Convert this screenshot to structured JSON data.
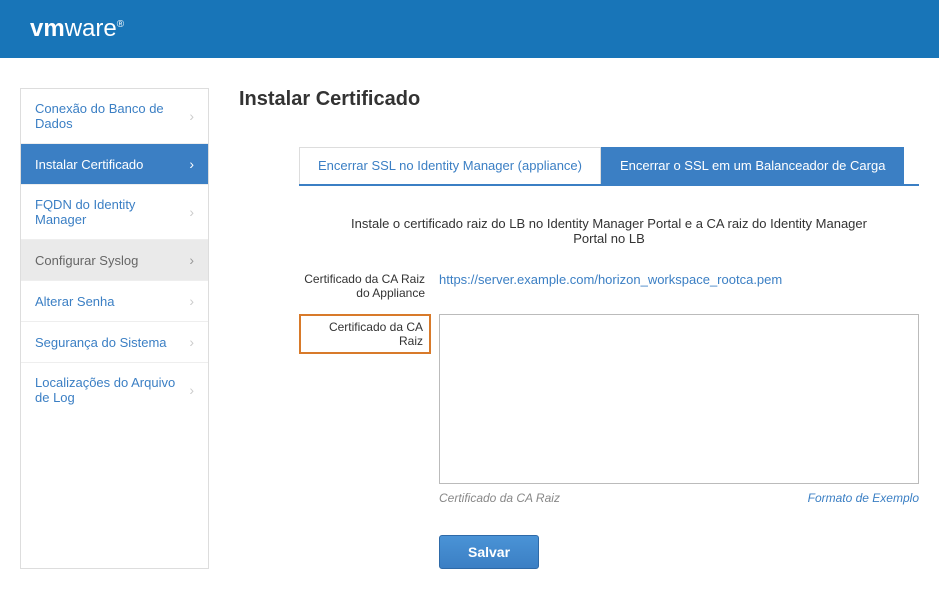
{
  "header": {
    "brand_prefix": "vm",
    "brand_suffix": "ware"
  },
  "sidebar": {
    "items": [
      {
        "label": "Conexão do Banco de Dados",
        "active": false
      },
      {
        "label": "Instalar Certificado",
        "active": true
      },
      {
        "label": "FQDN do Identity Manager",
        "active": false
      },
      {
        "label": "Configurar Syslog",
        "active": false,
        "hover": true
      },
      {
        "label": "Alterar Senha",
        "active": false
      },
      {
        "label": "Segurança do Sistema",
        "active": false
      },
      {
        "label": "Localizações do Arquivo de Log",
        "active": false
      }
    ]
  },
  "main": {
    "title": "Instalar Certificado",
    "tabs": [
      {
        "label": "Encerrar SSL no Identity Manager (appliance)",
        "active": false
      },
      {
        "label": "Encerrar o SSL em um Balanceador de Carga",
        "active": true
      }
    ],
    "description": "Instale o certificado raiz do LB no Identity Manager Portal e a CA raiz do Identity Manager Portal no LB",
    "fields": {
      "appliance_cert_label": "Certificado da CA Raiz do Appliance",
      "appliance_cert_link": "https://server.example.com/horizon_workspace_rootca.pem",
      "root_cert_label": "Certificado da CA Raiz",
      "root_cert_value": "",
      "root_cert_hint": "Certificado da CA Raiz",
      "example_format": "Formato de Exemplo"
    },
    "buttons": {
      "save": "Salvar"
    }
  }
}
